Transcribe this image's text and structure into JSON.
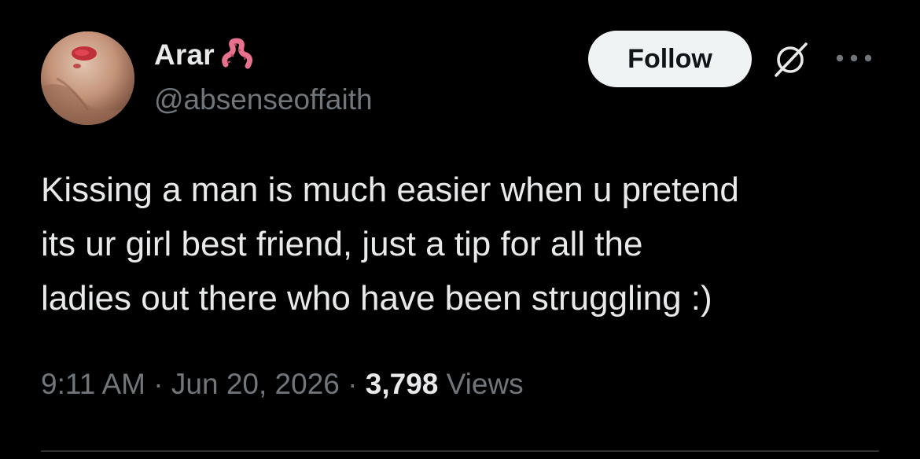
{
  "author": {
    "display_name": "Arar",
    "name_emoji": "worm-emoji",
    "handle": "@absenseoffaith"
  },
  "actions": {
    "follow_label": "Follow",
    "grok_icon": "grok-icon",
    "more_icon": "more-icon"
  },
  "tweet": {
    "lines": [
      "Kissing a man is much easier when u pretend",
      "its ur girl best friend, just a tip for all the",
      "ladies out there who have been struggling :)"
    ]
  },
  "meta": {
    "time": "9:11 AM",
    "separator": "·",
    "date": "Jun 20, 2026",
    "views_count": "3,798",
    "views_label": "Views"
  },
  "colors": {
    "background": "#000000",
    "text_primary": "#e7e9ea",
    "text_secondary": "#71767b",
    "button_bg": "#eff3f4",
    "divider": "#2f3336",
    "emoji_pink": "#e8718d"
  }
}
